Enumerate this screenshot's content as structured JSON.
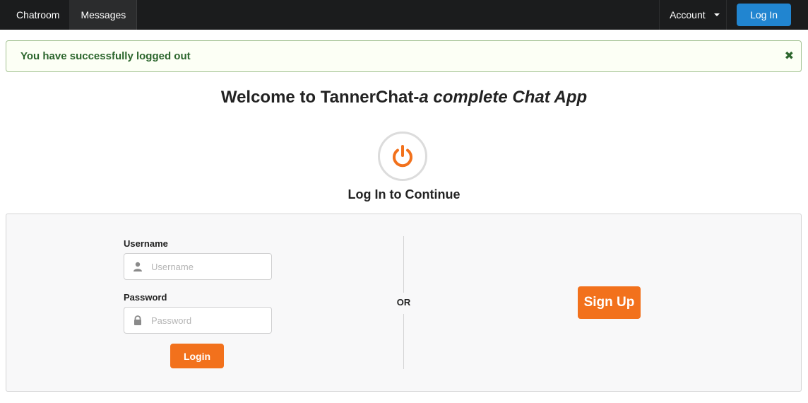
{
  "nav": {
    "items": [
      {
        "label": "Chatroom"
      },
      {
        "label": "Messages"
      }
    ],
    "account_label": "Account",
    "login_label": "Log In"
  },
  "alert": {
    "message": "You have successfully logged out"
  },
  "welcome": {
    "title_plain": "Welcome to TannerChat-",
    "title_italic": "a complete Chat App",
    "subtitle": "Log In to Continue"
  },
  "form": {
    "username_label": "Username",
    "username_placeholder": "Username",
    "username_value": "",
    "password_label": "Password",
    "password_placeholder": "Password",
    "password_value": "",
    "login_button": "Login",
    "or_text": "OR",
    "signup_button": "Sign Up"
  },
  "colors": {
    "navbar": "#1b1c1d",
    "primary_blue": "#2185d0",
    "accent_orange": "#f2711c",
    "success_text": "#2c662d",
    "success_bg": "#fcfff5"
  },
  "icons": {
    "power": "power-icon",
    "user": "user-icon",
    "lock": "lock-icon",
    "close": "close-icon",
    "dropdown": "caret-down-icon"
  }
}
